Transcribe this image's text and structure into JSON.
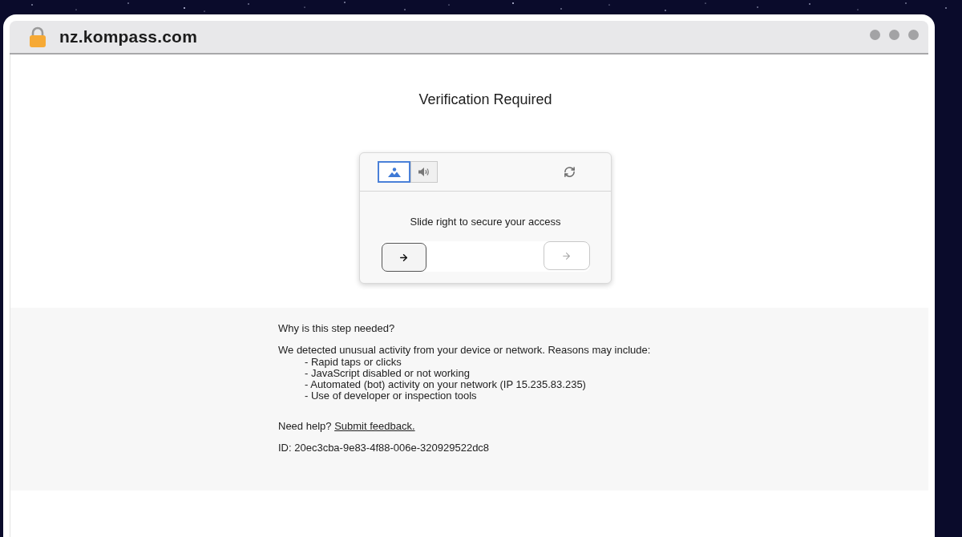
{
  "browser": {
    "address": "nz.kompass.com"
  },
  "page": {
    "title": "Verification Required"
  },
  "captcha": {
    "tabs": [
      {
        "kind": "image",
        "selected": true
      },
      {
        "kind": "audio",
        "selected": false
      }
    ],
    "instruction": "Slide right to secure your access",
    "slider": {
      "level": 0
    }
  },
  "info": {
    "heading": "Why is this step needed?",
    "intro": "We detected unusual activity from your device or network. Reasons may include:",
    "reasons": [
      "- Rapid taps or clicks",
      "- JavaScript disabled or not working",
      "- Automated (bot) activity on your network (IP 15.235.83.235)",
      "- Use of developer or inspection tools"
    ],
    "help": {
      "text": "Need help?",
      "link": "Submit feedback."
    },
    "id": "ID: 20ec3cba-9e83-4f88-006e-320929522dc8"
  }
}
